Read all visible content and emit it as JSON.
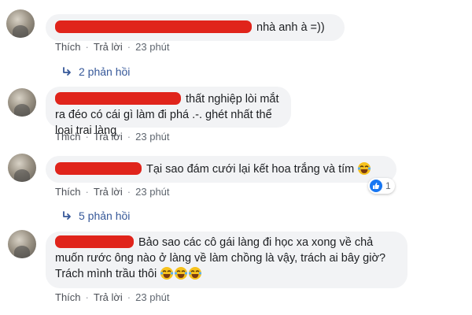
{
  "comments": [
    {
      "text_before": "",
      "text": "nhà anh à =))",
      "like_label": "Thích",
      "reply_label": "Trả lời",
      "time": "23 phút",
      "replies_label": "2 phản hồi"
    },
    {
      "text": "thất nghiệp lòi mắt ra đéo có cái gì làm đi phá .-. ghét nhất thể loại trai làng",
      "like_label": "Thích",
      "reply_label": "Trả lời",
      "time": "23 phút"
    },
    {
      "text": "Tại sao đám cưới lại kết hoa trắng và tím",
      "like_label": "Thích",
      "reply_label": "Trả lời",
      "time": "23 phút",
      "reaction_count": "1",
      "replies_label": "5 phản hồi"
    },
    {
      "text": "Bảo sao các cô gái làng đi học xa xong về chả muốn rước ông nào ở làng về làm chồng là vậy, trách ai bây giờ? Trách mình trầu thôi",
      "like_label": "Thích",
      "reply_label": "Trả lời",
      "time": "23 phút"
    }
  ],
  "icons": {
    "reply_arrow": "reply-arrow-icon",
    "emoji": "laughing-tears-emoji-icon",
    "like": "thumbs-up-icon"
  },
  "colors": {
    "link": "#365899",
    "redaction": "#e0241b",
    "like_badge": "#1877f2",
    "bubble": "#f2f3f5"
  }
}
